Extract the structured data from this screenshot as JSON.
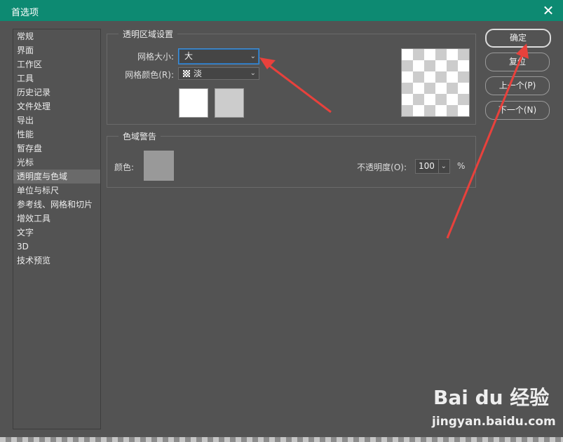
{
  "window": {
    "title": "首选项",
    "close_icon": "close-icon"
  },
  "sidebar": {
    "items": [
      {
        "label": "常规"
      },
      {
        "label": "界面"
      },
      {
        "label": "工作区"
      },
      {
        "label": "工具"
      },
      {
        "label": "历史记录"
      },
      {
        "label": "文件处理"
      },
      {
        "label": "导出"
      },
      {
        "label": "性能"
      },
      {
        "label": "暂存盘"
      },
      {
        "label": "光标"
      },
      {
        "label": "透明度与色域"
      },
      {
        "label": "单位与标尺"
      },
      {
        "label": "参考线、网格和切片"
      },
      {
        "label": "增效工具"
      },
      {
        "label": "文字"
      },
      {
        "label": "3D"
      },
      {
        "label": "技术预览"
      }
    ],
    "active": "透明度与色域"
  },
  "transparency": {
    "title": "透明区域设置",
    "grid_size_label": "网格大小:",
    "grid_size_value": "大",
    "grid_color_label": "网格颜色(R):",
    "grid_color_value": "淡",
    "swatch_1_color": "#ffffff",
    "swatch_2_color": "#cccccc"
  },
  "gamut": {
    "title": "色域警告",
    "color_label": "颜色:",
    "color_value": "#999999",
    "opacity_label": "不透明度(O):",
    "opacity_value": "100",
    "opacity_unit": "%"
  },
  "buttons": {
    "ok": "确定",
    "reset": "复位",
    "prev": "上一个(P)",
    "next": "下一个(N)"
  },
  "watermark": {
    "brand": "Bai du 经验",
    "url": "jingyan.baidu.com"
  },
  "colors": {
    "titlebar": "#0d8a72",
    "panel": "#535353",
    "arrow": "#e8413c"
  }
}
